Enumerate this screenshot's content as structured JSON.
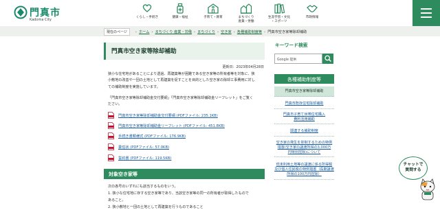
{
  "header": {
    "logo_ja": "門真市",
    "logo_en": "Kadoma City",
    "nav": [
      {
        "icon": "heart-hand-icon",
        "label": "くらし・手続き"
      },
      {
        "icon": "medical-bottle-icon",
        "label": "健康・福祉"
      },
      {
        "icon": "school-building-icon",
        "label": "子育て・教育"
      },
      {
        "icon": "town-houses-icon",
        "label": "まちづくり\n産業・労働"
      },
      {
        "icon": "books-icon",
        "label": "生涯学習・文化\n・スポーツ"
      },
      {
        "icon": "handshake-icon",
        "label": "市政情報"
      }
    ],
    "menu_icon": "hamburger-menu-icon"
  },
  "breadcrumb": {
    "lead": "現在のページ",
    "links": [
      "ホーム",
      "まちづくり 産業・労働",
      "まちづくり",
      "空き家",
      "各種補助制度等"
    ],
    "current": "門真市空き家等除却補助"
  },
  "main": {
    "title": "門真市空き家等除却補助",
    "updated": "更新日：2023年04月28日",
    "paragraph": [
      "狭小な住宅地があることにより透過、再建築等が困難である空き家等の所有者等を対象に、狭",
      "小敷地の改善や一団の土地として再建築を促すことを目的とした空き家の除却工事費用に対し",
      "ての補助制度を実施しています。"
    ],
    "note": [
      "「門真市空き家等除却補助金交付要綱」「門真市空き家等除却補助金リーフレット」をご覧く",
      "ださい。"
    ],
    "documents": [
      {
        "type": "pdf",
        "label": "門真市空き家等除却補助金交付要綱 (PDFファイル: 235.1KB)"
      },
      {
        "type": "pdf",
        "label": "門真市空き家等除却補助金リーフレット (PDFファイル: 451.8KB)"
      },
      {
        "type": "pdf",
        "label": "手続き書類様式 (PDFファイル: 176.9KB)"
      },
      {
        "type": "pdf",
        "label": "委任状 (PDFファイル: 57.0KB)"
      },
      {
        "type": "pdf",
        "label": "誓約書 (PDFファイル: 119.5KB)"
      }
    ],
    "section": {
      "title": "対象空き家等",
      "lines": [
        "次の各号のいずれにも該当するものをいう。",
        "1. 狭小な住宅地に存する空き家等であり、当該空き家等の同一の所有者が取得したもので",
        "   あること。",
        "2. 狭小敷地と一団の土地として再建築を行うものであること"
      ]
    }
  },
  "sidebar": {
    "keyword_title": "キーワード検索",
    "search_brand": "Google 提供",
    "search_icon": "magnifier-icon",
    "heading": "各種補助制度等",
    "items": [
      {
        "label": "門真市空き家等除却補助",
        "active": true
      },
      {
        "label": "門真市既存住宅除却補助",
        "active": false
      },
      {
        "label": "門真市子育て世帯住宅購入\n費利活用補助",
        "active": false
      },
      {
        "label": "関連する補助制度",
        "active": false
      },
      {
        "label": "空き家の発生を抑制するための特例\n措置(空き家の譲渡所得の3,000万\n円特別控除)について",
        "active": false
      },
      {
        "label": "低未利用土地等の譲渡に係る所得税\n及び個人住民税の特例措置（長期譲渡\n所得の100万円控除）",
        "active": false
      }
    ],
    "chatbot": "チャットで\n質問する"
  },
  "colors": {
    "brand_green": "#2e8b5e",
    "link_blue": "#1a5a9a",
    "pdf_red": "#c8102e"
  }
}
